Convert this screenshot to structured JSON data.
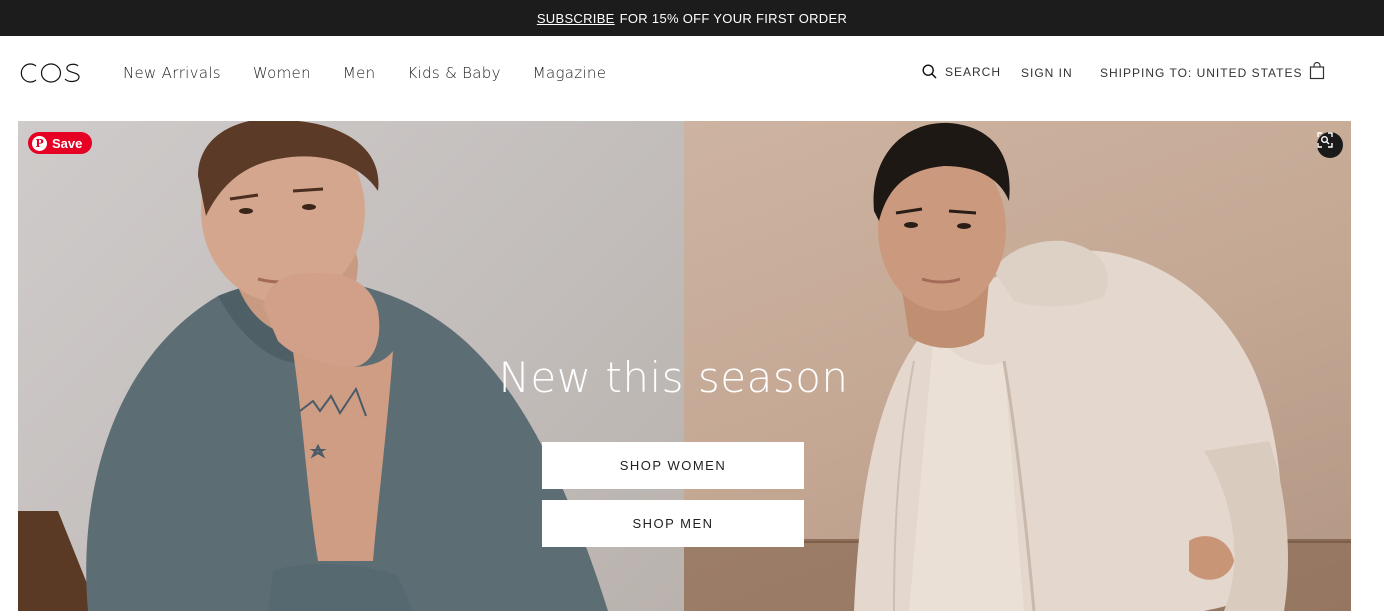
{
  "promo": {
    "link_text": "SUBSCRIBE",
    "text": "FOR 15% OFF YOUR FIRST ORDER"
  },
  "header": {
    "logo_text": "COS",
    "nav": [
      {
        "label": "New Arrivals"
      },
      {
        "label": "Women"
      },
      {
        "label": "Men"
      },
      {
        "label": "Kids & Baby"
      },
      {
        "label": "Magazine"
      }
    ],
    "search_label": "SEARCH",
    "signin_label": "SIGN IN",
    "shipping_label": "SHIPPING TO: UNITED STATES"
  },
  "hero": {
    "pin_label": "Save",
    "title": "New this season",
    "cta_women": "SHOP WOMEN",
    "cta_men": "SHOP MEN"
  }
}
